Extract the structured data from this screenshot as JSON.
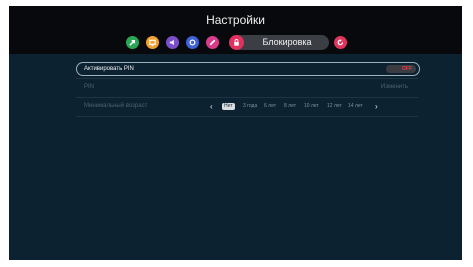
{
  "header": {
    "title": "Настройки",
    "tabs": [
      {
        "name": "tab-network",
        "color": "#2aa654",
        "icon": "arrow-icon"
      },
      {
        "name": "tab-display",
        "color": "#f0a030",
        "icon": "screen-icon"
      },
      {
        "name": "tab-audio",
        "color": "#7b4fc9",
        "icon": "speaker-icon"
      },
      {
        "name": "tab-general",
        "color": "#3d63d6",
        "icon": "gear-icon"
      },
      {
        "name": "tab-edit",
        "color": "#d63c8a",
        "icon": "pencil-icon"
      }
    ],
    "active_tab": {
      "label": "Блокировка",
      "color": "#e3305f",
      "icon": "lock-icon"
    },
    "last_tab": {
      "name": "tab-reset",
      "color": "#e0355c",
      "icon": "reset-icon"
    }
  },
  "settings": {
    "activate_pin": {
      "label": "Активировать PIN",
      "toggle": "OFF"
    },
    "pin_code": {
      "label": "PIN",
      "action": "Изменить"
    },
    "min_age": {
      "label": "Минимальный возраст",
      "options": [
        "Нет",
        "3 года",
        "6 лет",
        "8 лет",
        "10 лет",
        "12 лет",
        "14 лет"
      ],
      "selected": "Нет"
    }
  }
}
